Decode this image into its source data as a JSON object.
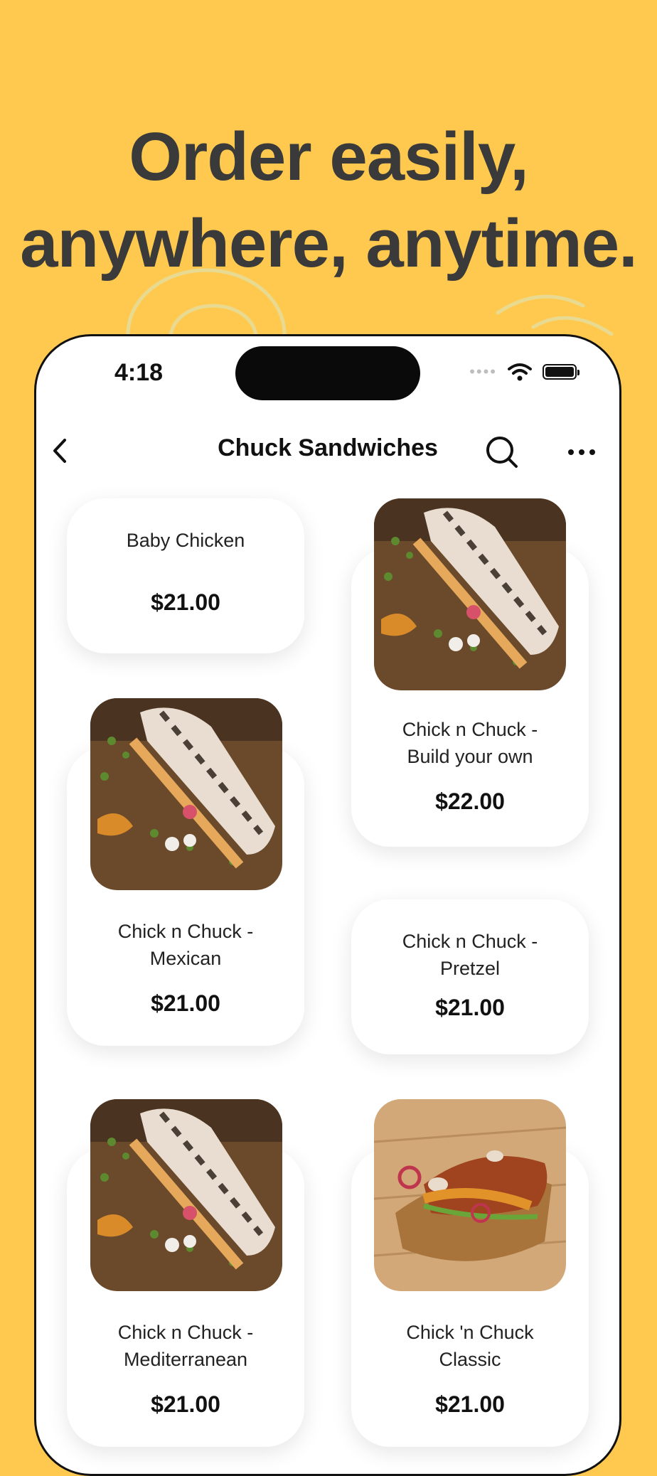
{
  "headline": {
    "line1": "Order easily,",
    "line2": "anywhere, anytime."
  },
  "status_bar": {
    "time": "4:18",
    "icons": [
      "signal-dots-icon",
      "wifi-icon",
      "battery-icon"
    ]
  },
  "nav": {
    "title": "Chuck Sandwiches",
    "back_icon": "chevron-left-icon",
    "search_icon": "search-icon",
    "more_icon": "more-dots-icon"
  },
  "items": [
    {
      "name": "Baby Chicken",
      "price": "$21.00",
      "image": "none"
    },
    {
      "name": "Chick n Chuck - Build your own",
      "price": "$22.00",
      "image": "grilled-baguette"
    },
    {
      "name": "Chick n Chuck - Mexican",
      "price": "$21.00",
      "image": "grilled-baguette"
    },
    {
      "name": "Chick n Chuck - Pretzel",
      "price": "$21.00",
      "image": "none"
    },
    {
      "name": "Chick n Chuck - Mediterranean",
      "price": "$21.00",
      "image": "grilled-baguette"
    },
    {
      "name": "Chick 'n Chuck Classic",
      "price": "$21.00",
      "image": "pretzel-sandwich"
    }
  ],
  "colors": {
    "background": "#FFC94F",
    "headline": "#3a3a3a",
    "card": "#ffffff"
  }
}
